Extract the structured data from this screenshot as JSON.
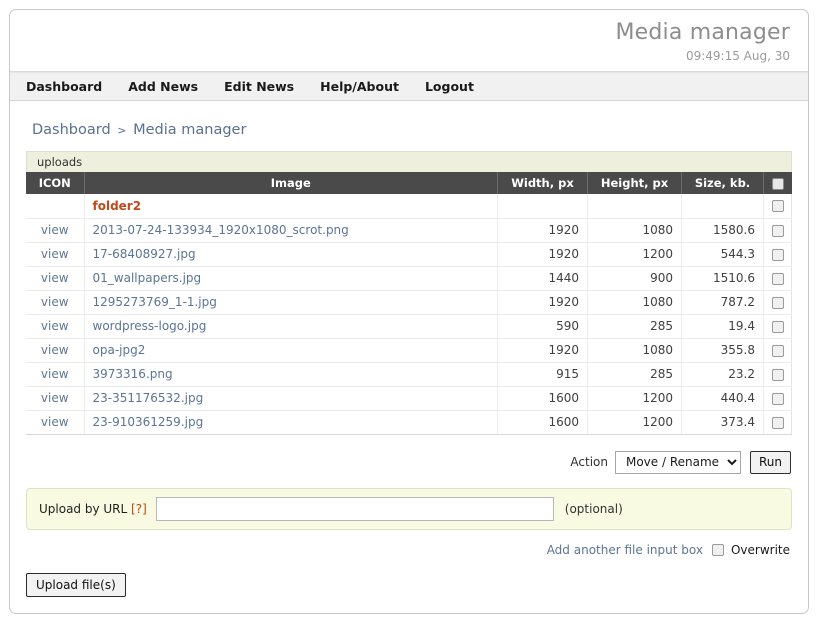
{
  "app": {
    "title": "Media manager",
    "timestamp": "09:49:15 Aug, 30"
  },
  "nav": {
    "items": [
      {
        "label": "Dashboard"
      },
      {
        "label": "Add News"
      },
      {
        "label": "Edit News"
      },
      {
        "label": "Help/About"
      },
      {
        "label": "Logout"
      }
    ]
  },
  "breadcrumb": {
    "root": "Dashboard",
    "separator": ">",
    "current": "Media manager"
  },
  "panel": {
    "folder_bar_label": "uploads"
  },
  "table": {
    "headers": {
      "icon": "ICON",
      "image": "Image",
      "width": "Width, px",
      "height": "Height, px",
      "size": "Size, kb.",
      "select_all": ""
    },
    "folder_row": {
      "view": "",
      "name": "folder2",
      "width": "",
      "height": "",
      "size": ""
    },
    "rows": [
      {
        "view": "view",
        "name": "2013-07-24-133934_1920x1080_scrot.png",
        "width": "1920",
        "height": "1080",
        "size": "1580.6"
      },
      {
        "view": "view",
        "name": "17-68408927.jpg",
        "width": "1920",
        "height": "1200",
        "size": "544.3"
      },
      {
        "view": "view",
        "name": "01_wallpapers.jpg",
        "width": "1440",
        "height": "900",
        "size": "1510.6"
      },
      {
        "view": "view",
        "name": "1295273769_1-1.jpg",
        "width": "1920",
        "height": "1080",
        "size": "787.2"
      },
      {
        "view": "view",
        "name": "wordpress-logo.jpg",
        "width": "590",
        "height": "285",
        "size": "19.4"
      },
      {
        "view": "view",
        "name": "opa-jpg2",
        "width": "1920",
        "height": "1080",
        "size": "355.8"
      },
      {
        "view": "view",
        "name": "3973316.png",
        "width": "915",
        "height": "285",
        "size": "23.2"
      },
      {
        "view": "view",
        "name": "23-351176532.jpg",
        "width": "1600",
        "height": "1200",
        "size": "440.4"
      },
      {
        "view": "view",
        "name": "23-910361259.jpg",
        "width": "1600",
        "height": "1200",
        "size": "373.4"
      }
    ]
  },
  "actions": {
    "label": "Action",
    "selected": "Move / Rename",
    "options": [
      "Move / Rename"
    ],
    "run_label": "Run"
  },
  "upload": {
    "label": "Upload by URL",
    "help_marker": "[?]",
    "url_value": "",
    "url_placeholder": "",
    "optional_text": "(optional)",
    "add_input_label": "Add another file input box",
    "overwrite_label": "Overwrite",
    "submit_label": "Upload file(s)"
  },
  "colors": {
    "header_title": "#8d8d8d",
    "nav_bg": "#f1f1f1",
    "table_header_bg": "#4a4a4a",
    "uploads_bar_bg": "#eef0dd",
    "folder_link": "#c1491a",
    "link": "#5c7496",
    "upload_panel_bg": "#f8fae1"
  }
}
